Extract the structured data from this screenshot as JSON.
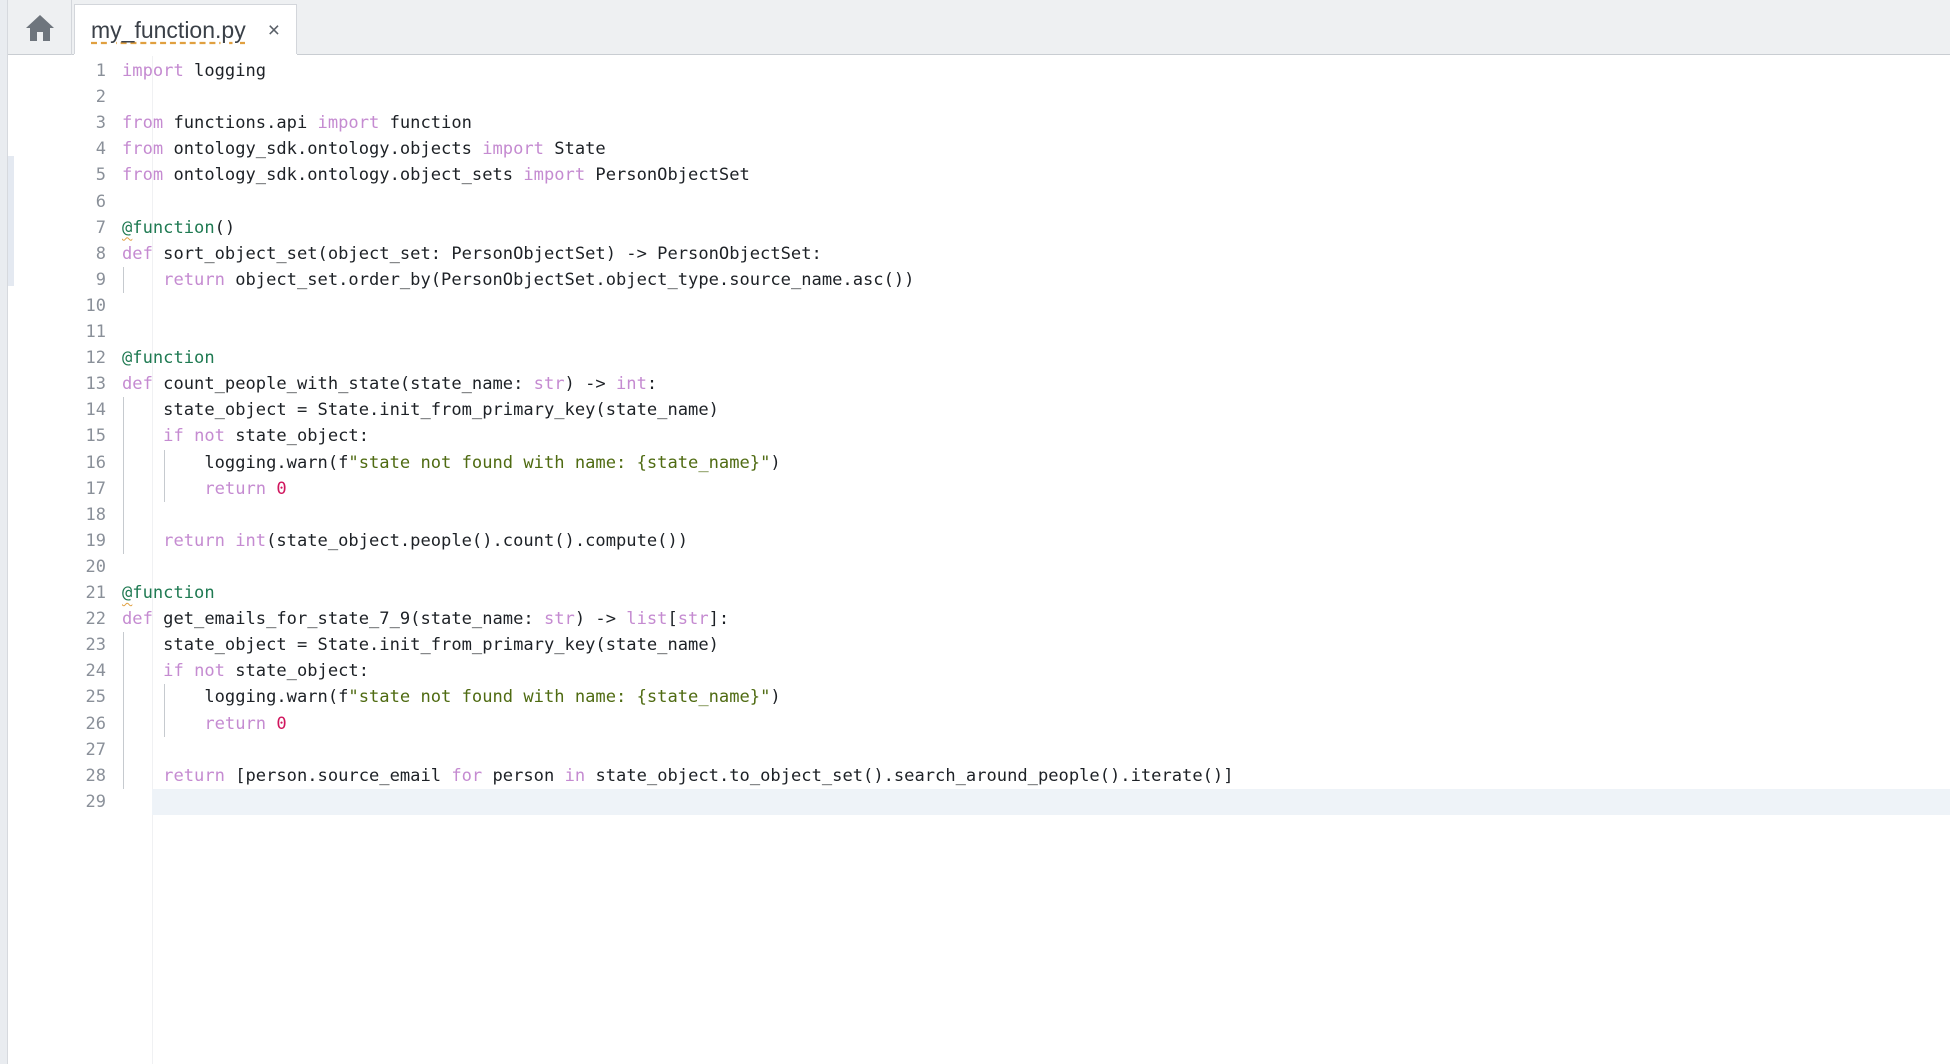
{
  "tabs": [
    {
      "label": "my_function.py",
      "close_glyph": "×",
      "active": true
    }
  ],
  "home_icon": "home-icon",
  "editor": {
    "current_line": 29,
    "lines": [
      {
        "n": "1",
        "tokens": [
          [
            "kw",
            "import"
          ],
          [
            "t",
            " logging"
          ]
        ]
      },
      {
        "n": "2",
        "tokens": []
      },
      {
        "n": "3",
        "tokens": [
          [
            "kw",
            "from"
          ],
          [
            "t",
            " functions.api "
          ],
          [
            "kw",
            "import"
          ],
          [
            "t",
            " function"
          ]
        ]
      },
      {
        "n": "4",
        "tokens": [
          [
            "kw",
            "from"
          ],
          [
            "t",
            " ontology_sdk.ontology.objects "
          ],
          [
            "kw",
            "import"
          ],
          [
            "t",
            " State"
          ]
        ]
      },
      {
        "n": "5",
        "tokens": [
          [
            "kw",
            "from"
          ],
          [
            "t",
            " ontology_sdk.ontology.object_sets "
          ],
          [
            "kw",
            "import"
          ],
          [
            "t",
            " PersonObjectSet"
          ]
        ]
      },
      {
        "n": "6",
        "tokens": []
      },
      {
        "n": "7",
        "tokens": [
          [
            "decsq",
            "@"
          ],
          [
            "dec",
            "function"
          ],
          [
            "t",
            "()"
          ]
        ]
      },
      {
        "n": "8",
        "tokens": [
          [
            "kw",
            "def"
          ],
          [
            "t",
            " sort_object_set(object_set: PersonObjectSet) -> PersonObjectSet:"
          ]
        ]
      },
      {
        "n": "9",
        "tokens": [
          [
            "t",
            "    "
          ],
          [
            "kw",
            "return"
          ],
          [
            "t",
            " object_set.order_by(PersonObjectSet.object_type.source_name.asc())"
          ]
        ]
      },
      {
        "n": "10",
        "tokens": []
      },
      {
        "n": "11",
        "tokens": []
      },
      {
        "n": "12",
        "tokens": [
          [
            "dec",
            "@function"
          ]
        ]
      },
      {
        "n": "13",
        "tokens": [
          [
            "kw",
            "def"
          ],
          [
            "t",
            " count_people_with_state(state_name: "
          ],
          [
            "kw",
            "str"
          ],
          [
            "t",
            ") -> "
          ],
          [
            "kw",
            "int"
          ],
          [
            "t",
            ":"
          ]
        ]
      },
      {
        "n": "14",
        "tokens": [
          [
            "t",
            "    state_object = State.init_from_primary_key(state_name)"
          ]
        ]
      },
      {
        "n": "15",
        "tokens": [
          [
            "t",
            "    "
          ],
          [
            "kw",
            "if"
          ],
          [
            "t",
            " "
          ],
          [
            "kw",
            "not"
          ],
          [
            "t",
            " state_object:"
          ]
        ]
      },
      {
        "n": "16",
        "tokens": [
          [
            "t",
            "        logging.warn(f"
          ],
          [
            "str",
            "\"state not found with name: {state_name}\""
          ],
          [
            "t",
            ")"
          ]
        ]
      },
      {
        "n": "17",
        "tokens": [
          [
            "t",
            "        "
          ],
          [
            "kw",
            "return"
          ],
          [
            "t",
            " "
          ],
          [
            "num",
            "0"
          ]
        ]
      },
      {
        "n": "18",
        "tokens": []
      },
      {
        "n": "19",
        "tokens": [
          [
            "t",
            "    "
          ],
          [
            "kw",
            "return"
          ],
          [
            "t",
            " "
          ],
          [
            "kw",
            "int"
          ],
          [
            "t",
            "(state_object.people().count().compute())"
          ]
        ]
      },
      {
        "n": "20",
        "tokens": []
      },
      {
        "n": "21",
        "tokens": [
          [
            "decsq",
            "@"
          ],
          [
            "dec",
            "function"
          ]
        ]
      },
      {
        "n": "22",
        "tokens": [
          [
            "kw",
            "def"
          ],
          [
            "t",
            " get_emails_for_state_7_9(state_name: "
          ],
          [
            "kw",
            "str"
          ],
          [
            "t",
            ") -> "
          ],
          [
            "kw",
            "list"
          ],
          [
            "t",
            "["
          ],
          [
            "kw",
            "str"
          ],
          [
            "t",
            "]:"
          ]
        ]
      },
      {
        "n": "23",
        "tokens": [
          [
            "t",
            "    state_object = State.init_from_primary_key(state_name)"
          ]
        ]
      },
      {
        "n": "24",
        "tokens": [
          [
            "t",
            "    "
          ],
          [
            "kw",
            "if"
          ],
          [
            "t",
            " "
          ],
          [
            "kw",
            "not"
          ],
          [
            "t",
            " state_object:"
          ]
        ]
      },
      {
        "n": "25",
        "tokens": [
          [
            "t",
            "        logging.warn(f"
          ],
          [
            "str",
            "\"state not found with name: {state_name}\""
          ],
          [
            "t",
            ")"
          ]
        ]
      },
      {
        "n": "26",
        "tokens": [
          [
            "t",
            "        "
          ],
          [
            "kw",
            "return"
          ],
          [
            "t",
            " "
          ],
          [
            "num",
            "0"
          ]
        ]
      },
      {
        "n": "27",
        "tokens": []
      },
      {
        "n": "28",
        "tokens": [
          [
            "t",
            "    "
          ],
          [
            "kw",
            "return"
          ],
          [
            "t",
            " [person.source_email "
          ],
          [
            "kw",
            "for"
          ],
          [
            "t",
            " person "
          ],
          [
            "kw",
            "in"
          ],
          [
            "t",
            " state_object.to_object_set().search_around_people().iterate()]"
          ]
        ]
      },
      {
        "n": "29",
        "tokens": []
      }
    ]
  }
}
